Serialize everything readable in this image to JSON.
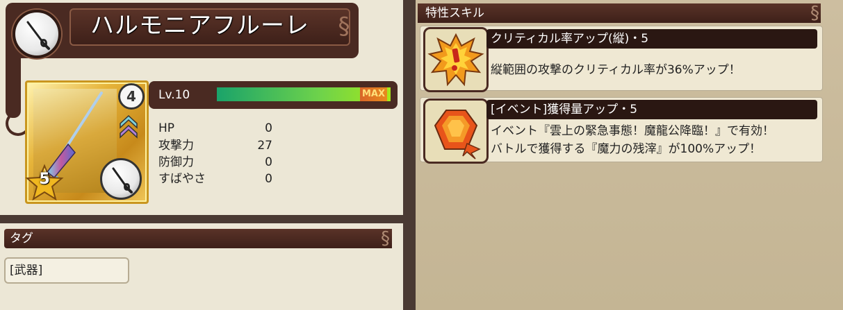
{
  "item": {
    "name": "ハルモニアフルーレ",
    "rank": "4",
    "stars": "5"
  },
  "level": {
    "label": "Lv.10",
    "max_label": "MAX",
    "progress_percent": 100
  },
  "stats": [
    {
      "label": "HP",
      "value": "0"
    },
    {
      "label": "攻撃力",
      "value": "27"
    },
    {
      "label": "防御力",
      "value": "0"
    },
    {
      "label": "すばやさ",
      "value": "0"
    }
  ],
  "tags": {
    "header": "タグ",
    "items": [
      "[武器]"
    ]
  },
  "skills": {
    "header": "特性スキル",
    "items": [
      {
        "icon": "critical-burst-icon",
        "title": "クリティカル率アップ(縦)・5",
        "desc_lines": [
          "縦範囲の攻撃のクリティカル率が36%アップ！"
        ]
      },
      {
        "icon": "orange-gem-icon",
        "title": "[イベント]獲得量アップ・5",
        "desc_lines": [
          "イベント『雲上の緊急事態！魔龍公降臨！』で有効！",
          "バトルで獲得する『魔力の残滓』が100%アップ！"
        ]
      }
    ]
  },
  "colors": {
    "frame": "#4a2a22",
    "panel_bg": "#ece7d6",
    "right_bg": "#c8b898",
    "gauge_fill": "#6fd34a"
  }
}
